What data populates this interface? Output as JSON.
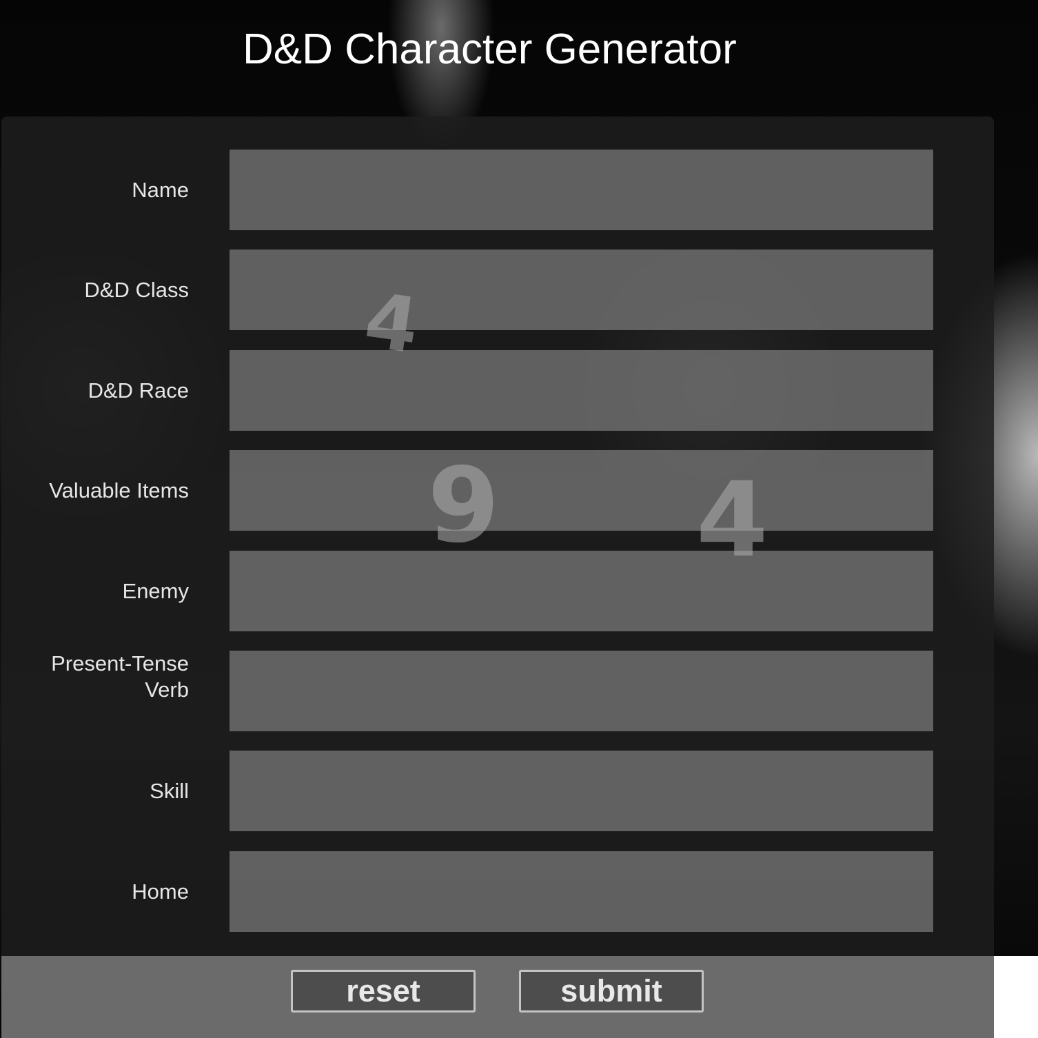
{
  "page": {
    "title": "D&D Character Generator"
  },
  "form": {
    "fields": [
      {
        "label": "Name",
        "value": ""
      },
      {
        "label": "D&D Class",
        "value": ""
      },
      {
        "label": "D&D Race",
        "value": ""
      },
      {
        "label": "Valuable Items",
        "value": ""
      },
      {
        "label": "Enemy",
        "value": ""
      },
      {
        "label": "Present-Tense Verb",
        "value": ""
      },
      {
        "label": "Skill",
        "value": ""
      },
      {
        "label": "Home",
        "value": ""
      }
    ]
  },
  "buttons": {
    "reset_label": "reset",
    "submit_label": "submit"
  },
  "colors": {
    "title": "#ffffff",
    "panel": "#1e1e1e",
    "input": "#7a7a7a",
    "footer": "#6b6b6b",
    "button": "#4d4d4d",
    "button_border": "#c4c4c4"
  }
}
